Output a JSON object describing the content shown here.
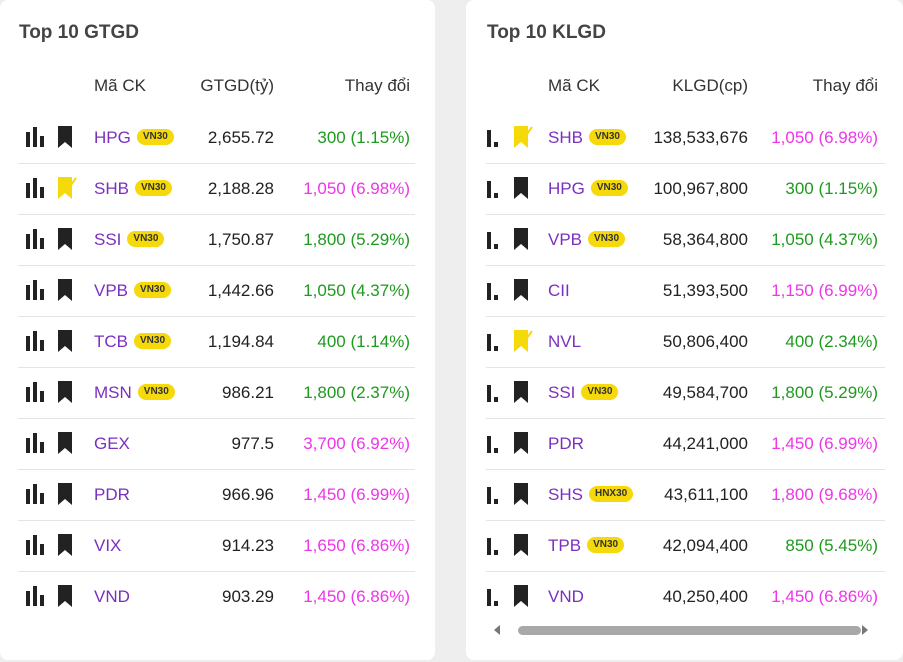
{
  "colors": {
    "symbol": "#7b2fbe",
    "up": "#1e9a1e",
    "ceiling": "#ee35e8",
    "badge": "#f5d90a",
    "watch_active": "#f5d90a",
    "icon": "#222222"
  },
  "left": {
    "title": "Top 10 GTGD",
    "headers": {
      "symbol": "Mã CK",
      "value": "GTGD(tỷ)",
      "change": "Thay đổi"
    },
    "rows": [
      {
        "symbol": "HPG",
        "badge": "VN30",
        "value": "2,655.72",
        "change": "300 (1.15%)",
        "trend": "up",
        "watched": false
      },
      {
        "symbol": "SHB",
        "badge": "VN30",
        "value": "2,188.28",
        "change": "1,050 (6.98%)",
        "trend": "ceil",
        "watched": true
      },
      {
        "symbol": "SSI",
        "badge": "VN30",
        "value": "1,750.87",
        "change": "1,800 (5.29%)",
        "trend": "up",
        "watched": false
      },
      {
        "symbol": "VPB",
        "badge": "VN30",
        "value": "1,442.66",
        "change": "1,050 (4.37%)",
        "trend": "up",
        "watched": false
      },
      {
        "symbol": "TCB",
        "badge": "VN30",
        "value": "1,194.84",
        "change": "400 (1.14%)",
        "trend": "up",
        "watched": false
      },
      {
        "symbol": "MSN",
        "badge": "VN30",
        "value": "986.21",
        "change": "1,800 (2.37%)",
        "trend": "up",
        "watched": false
      },
      {
        "symbol": "GEX",
        "badge": "",
        "value": "977.5",
        "change": "3,700 (6.92%)",
        "trend": "ceil",
        "watched": false
      },
      {
        "symbol": "PDR",
        "badge": "",
        "value": "966.96",
        "change": "1,450 (6.99%)",
        "trend": "ceil",
        "watched": false
      },
      {
        "symbol": "VIX",
        "badge": "",
        "value": "914.23",
        "change": "1,650 (6.86%)",
        "trend": "ceil",
        "watched": false
      },
      {
        "symbol": "VND",
        "badge": "",
        "value": "903.29",
        "change": "1,450 (6.86%)",
        "trend": "ceil",
        "watched": false
      }
    ]
  },
  "right": {
    "title": "Top 10 KLGD",
    "headers": {
      "symbol": "Mã CK",
      "value": "KLGD(cp)",
      "change": "Thay đổi"
    },
    "rows": [
      {
        "symbol": "SHB",
        "badge": "VN30",
        "value": "138,533,676",
        "change": "1,050 (6.98%)",
        "trend": "ceil",
        "watched": true
      },
      {
        "symbol": "HPG",
        "badge": "VN30",
        "value": "100,967,800",
        "change": "300 (1.15%)",
        "trend": "up",
        "watched": false
      },
      {
        "symbol": "VPB",
        "badge": "VN30",
        "value": "58,364,800",
        "change": "1,050 (4.37%)",
        "trend": "up",
        "watched": false
      },
      {
        "symbol": "CII",
        "badge": "",
        "value": "51,393,500",
        "change": "1,150 (6.99%)",
        "trend": "ceil",
        "watched": false
      },
      {
        "symbol": "NVL",
        "badge": "",
        "value": "50,806,400",
        "change": "400 (2.34%)",
        "trend": "up",
        "watched": true
      },
      {
        "symbol": "SSI",
        "badge": "VN30",
        "value": "49,584,700",
        "change": "1,800 (5.29%)",
        "trend": "up",
        "watched": false
      },
      {
        "symbol": "PDR",
        "badge": "",
        "value": "44,241,000",
        "change": "1,450 (6.99%)",
        "trend": "ceil",
        "watched": false
      },
      {
        "symbol": "SHS",
        "badge": "HNX30",
        "value": "43,611,100",
        "change": "1,800 (9.68%)",
        "trend": "ceil",
        "watched": false
      },
      {
        "symbol": "TPB",
        "badge": "VN30",
        "value": "42,094,400",
        "change": "850 (5.45%)",
        "trend": "up",
        "watched": false
      },
      {
        "symbol": "VND",
        "badge": "",
        "value": "40,250,400",
        "change": "1,450 (6.86%)",
        "trend": "ceil",
        "watched": false
      }
    ]
  }
}
